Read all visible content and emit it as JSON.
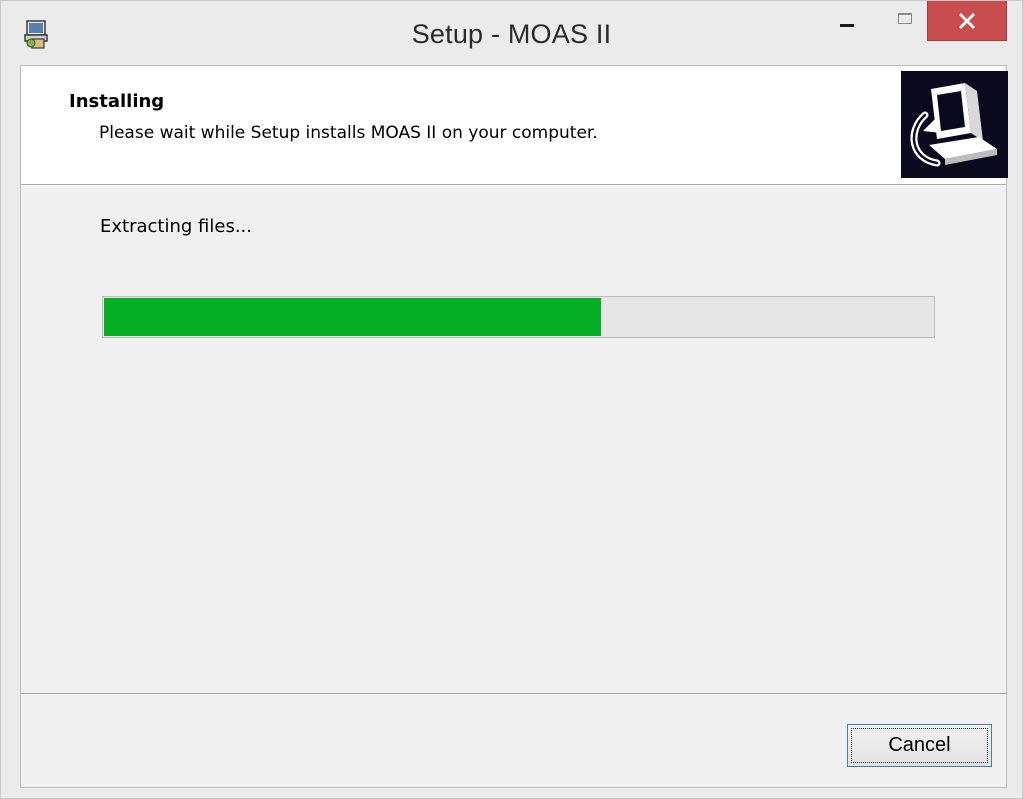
{
  "window": {
    "title": "Setup - MOAS II",
    "close_glyph": "✕",
    "icons": [
      "installer-app-icon",
      "minimize-icon",
      "maximize-icon",
      "close-icon"
    ]
  },
  "header": {
    "title": "Installing",
    "subtitle": "Please wait while Setup installs MOAS II on your computer.",
    "image": "computer-install-icon"
  },
  "body": {
    "status": "Extracting files...",
    "progress_fraction": 0.6,
    "progress_color": "#06b025"
  },
  "footer": {
    "cancel_label": "Cancel"
  },
  "colors": {
    "close_button": "#c74d4f",
    "focus_border": "#3c7fb1"
  }
}
